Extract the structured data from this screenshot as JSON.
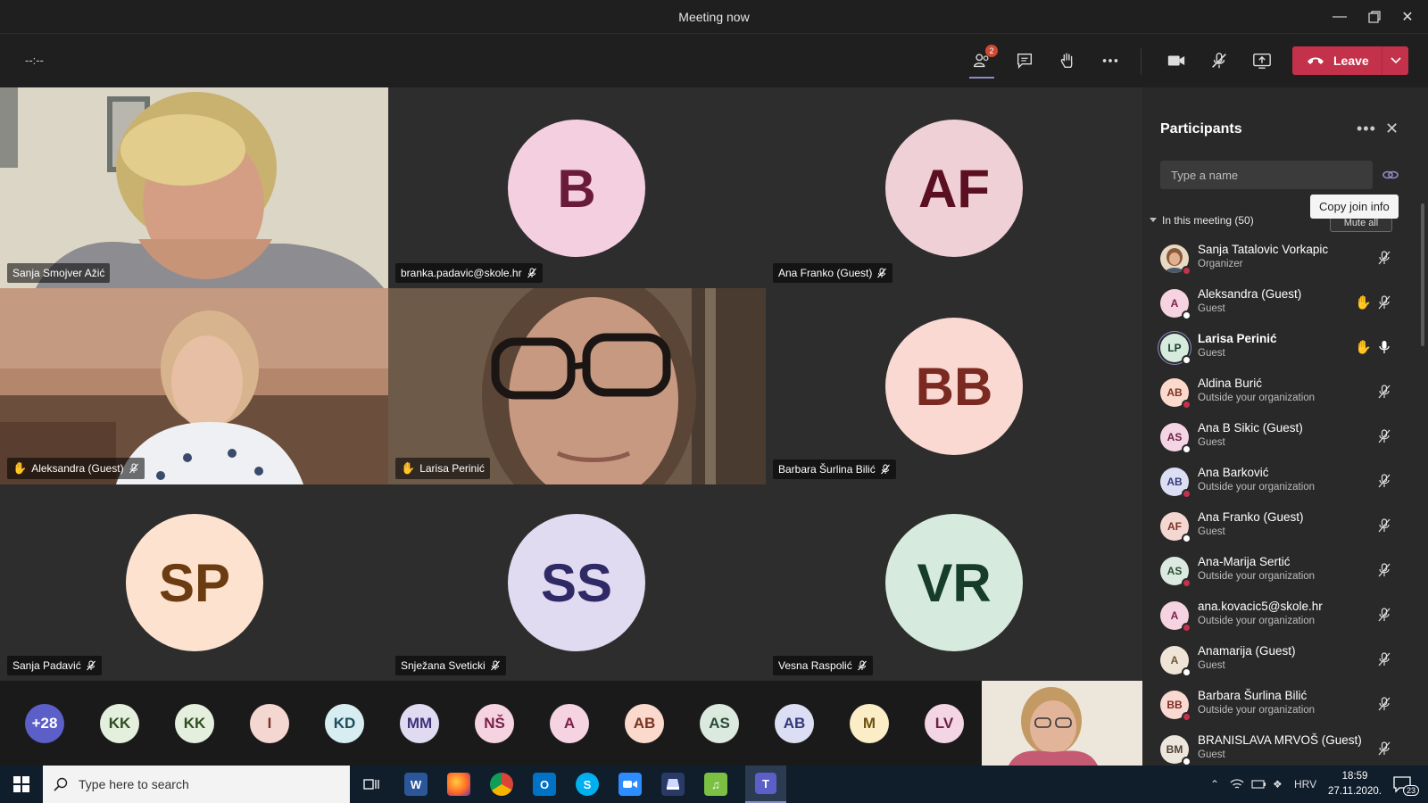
{
  "window": {
    "title": "Meeting now"
  },
  "toolbar": {
    "timer": "--:--",
    "participants_badge": "2",
    "leave_label": "Leave"
  },
  "tiles": [
    {
      "name": "Sanja Smojver Ažić",
      "kind": "video"
    },
    {
      "name": "branka.padavic@skole.hr",
      "initials": "B",
      "bg": "#f4cfe0",
      "fg": "#6a1b3a"
    },
    {
      "name": "Ana Franko (Guest)",
      "initials": "AF",
      "bg": "#eed0d6",
      "fg": "#5a1020"
    },
    {
      "name": "Aleksandra (Guest)",
      "kind": "video",
      "hand": true
    },
    {
      "name": "Larisa Perinić",
      "kind": "video",
      "hand": true
    },
    {
      "name": "Barbara Šurlina Bilić",
      "initials": "BB",
      "bg": "#fbd9d3",
      "fg": "#7a2a20"
    },
    {
      "name": "Sanja Padavić",
      "initials": "SP",
      "bg": "#fde3cf",
      "fg": "#6b3c12"
    },
    {
      "name": "Snježana Sveticki",
      "initials": "SS",
      "bg": "#e0dbf0",
      "fg": "#2f2a66"
    },
    {
      "name": "Vesna Raspolić",
      "initials": "VR",
      "bg": "#d6eadd",
      "fg": "#163d27"
    }
  ],
  "strip": [
    {
      "label": "+28",
      "bg": "#5b5fc7",
      "fg": "#ffffff"
    },
    {
      "label": "KK",
      "bg": "#e4efdd",
      "fg": "#2f4d22"
    },
    {
      "label": "KK",
      "bg": "#e4efdd",
      "fg": "#2f4d22"
    },
    {
      "label": "I",
      "bg": "#f5d7d2",
      "fg": "#7a3327"
    },
    {
      "label": "KD",
      "bg": "#d8edf2",
      "fg": "#1d4e5c"
    },
    {
      "label": "MM",
      "bg": "#e0dbf0",
      "fg": "#3e3479"
    },
    {
      "label": "NŠ",
      "bg": "#f6d3e1",
      "fg": "#7a1f48"
    },
    {
      "label": "A",
      "bg": "#f6d3e1",
      "fg": "#7a1f48"
    },
    {
      "label": "AB",
      "bg": "#fbd9cd",
      "fg": "#7a3420"
    },
    {
      "label": "AS",
      "bg": "#dbe9df",
      "fg": "#2a4d35"
    },
    {
      "label": "AB",
      "bg": "#dcdff3",
      "fg": "#33397a"
    },
    {
      "label": "M",
      "bg": "#fbedc5",
      "fg": "#6e5311"
    },
    {
      "label": "LV",
      "bg": "#f4d5e3",
      "fg": "#6d2146"
    }
  ],
  "panel": {
    "title": "Participants",
    "search_placeholder": "Type a name",
    "tooltip": "Copy join info",
    "mute_all": "Mute all",
    "section": "In this meeting (50)",
    "people": [
      {
        "name": "Sanja Tatalovic Vorkapic",
        "role": "Organizer",
        "initials": "",
        "bg": "#a78063",
        "fg": "#fff",
        "status": "#c4314b",
        "hand": false,
        "mic": "muted",
        "photo": true
      },
      {
        "name": "Aleksandra (Guest)",
        "role": "Guest",
        "initials": "A",
        "bg": "#f6d3e1",
        "fg": "#7a1f48",
        "status": "#ffffff",
        "hand": true,
        "mic": "muted"
      },
      {
        "name": "Larisa Perinić",
        "role": "Guest",
        "initials": "LP",
        "bg": "#d6eadd",
        "fg": "#163d27",
        "status": "#ffffff",
        "hand": true,
        "mic": "on",
        "bold": true
      },
      {
        "name": "Aldina Burić",
        "role": "Outside your organization",
        "initials": "AB",
        "bg": "#fbd9cd",
        "fg": "#7a3420",
        "status": "#c4314b",
        "hand": false,
        "mic": "muted"
      },
      {
        "name": "Ana B Sikic (Guest)",
        "role": "Guest",
        "initials": "AS",
        "bg": "#f4d5e3",
        "fg": "#6d2146",
        "status": "#ffffff",
        "hand": false,
        "mic": "muted"
      },
      {
        "name": "Ana Barković",
        "role": "Outside your organization",
        "initials": "AB",
        "bg": "#dcdff3",
        "fg": "#33397a",
        "status": "#c4314b",
        "hand": false,
        "mic": "muted"
      },
      {
        "name": "Ana Franko (Guest)",
        "role": "Guest",
        "initials": "AF",
        "bg": "#f5d7d2",
        "fg": "#7a3327",
        "status": "#ffffff",
        "hand": false,
        "mic": "muted"
      },
      {
        "name": "Ana-Marija Sertić",
        "role": "Outside your organization",
        "initials": "AS",
        "bg": "#dbe9df",
        "fg": "#2a4d35",
        "status": "#c4314b",
        "hand": false,
        "mic": "muted"
      },
      {
        "name": "ana.kovacic5@skole.hr",
        "role": "Outside your organization",
        "initials": "A",
        "bg": "#f6d3e1",
        "fg": "#7a1f48",
        "status": "#c4314b",
        "hand": false,
        "mic": "muted"
      },
      {
        "name": "Anamarija (Guest)",
        "role": "Guest",
        "initials": "A",
        "bg": "#efe5d6",
        "fg": "#6b5532",
        "status": "#ffffff",
        "hand": false,
        "mic": "muted"
      },
      {
        "name": "Barbara Šurlina Bilić",
        "role": "Outside your organization",
        "initials": "BB",
        "bg": "#fbd9d3",
        "fg": "#7a2a20",
        "status": "#c4314b",
        "hand": false,
        "mic": "muted"
      },
      {
        "name": "BRANISLAVA MRVOŠ (Guest)",
        "role": "Guest",
        "initials": "BM",
        "bg": "#ece6dc",
        "fg": "#4d4030",
        "status": "#ffffff",
        "hand": false,
        "mic": "muted"
      }
    ]
  },
  "taskbar": {
    "search_placeholder": "Type here to search",
    "language": "HRV",
    "time": "18:59",
    "date": "27.11.2020.",
    "notifications": "23"
  }
}
